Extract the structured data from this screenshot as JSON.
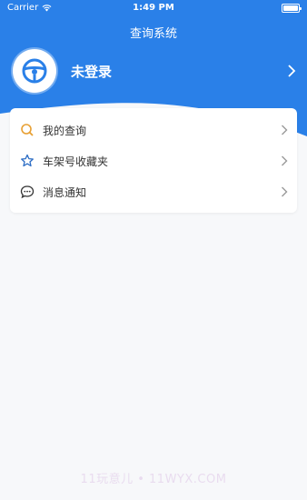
{
  "status_bar": {
    "carrier": "Carrier",
    "time": "1:49 PM",
    "battery_level": 1.0
  },
  "header": {
    "title": "查询系统"
  },
  "profile": {
    "avatar_icon": "steering-wheel-icon",
    "name": "未登录"
  },
  "menu": {
    "items": [
      {
        "label": "我的查询",
        "icon": "search-icon",
        "icon_color": "#e8a034"
      },
      {
        "label": "车架号收藏夹",
        "icon": "star-icon",
        "icon_color": "#2b6cc4"
      },
      {
        "label": "消息通知",
        "icon": "chat-bubble-icon",
        "icon_color": "#333333"
      }
    ]
  },
  "watermark": "11玩意儿 • 11WYX.COM",
  "colors": {
    "brand_blue": "#2a80e8",
    "background": "#f7f8fa"
  }
}
